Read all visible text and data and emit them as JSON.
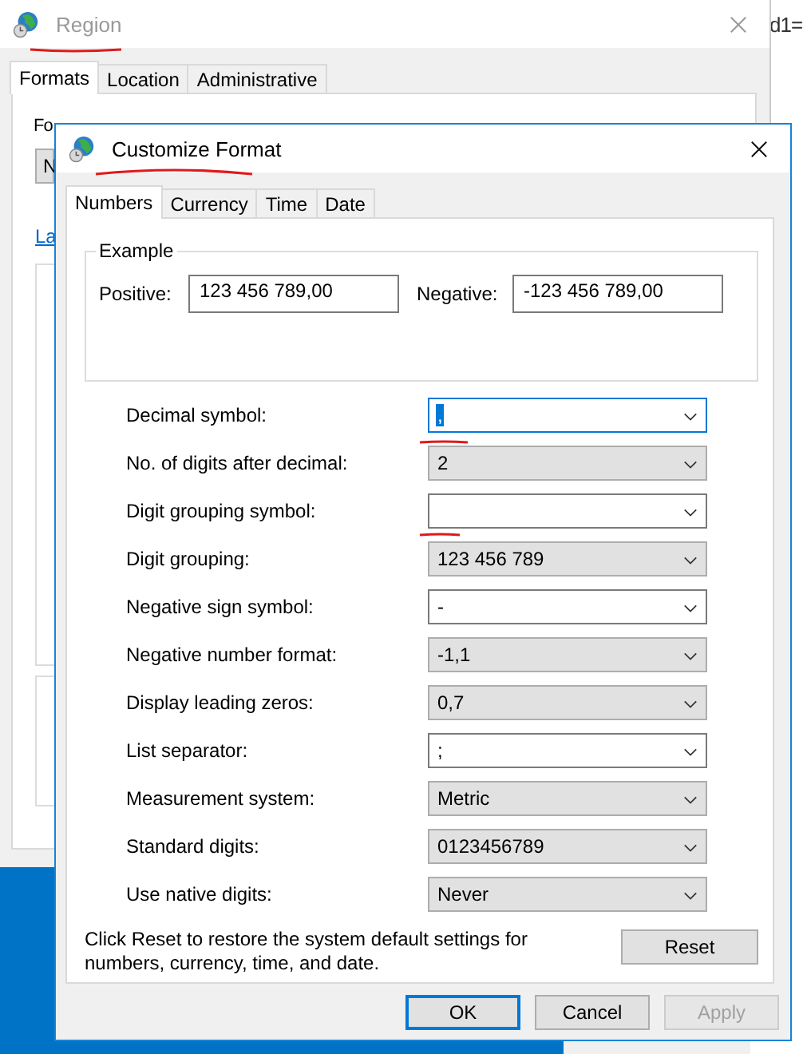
{
  "background_app": {
    "text": "d1="
  },
  "region_window": {
    "title": "Region",
    "tabs": [
      {
        "label": "Formats",
        "selected": true
      },
      {
        "label": "Location",
        "selected": false
      },
      {
        "label": "Administrative",
        "selected": false
      }
    ],
    "format_label": "Fo",
    "format_combo": "N",
    "link": "La"
  },
  "dialog": {
    "title": "Customize Format",
    "tabs": [
      {
        "label": "Numbers",
        "selected": true
      },
      {
        "label": "Currency",
        "selected": false
      },
      {
        "label": "Time",
        "selected": false
      },
      {
        "label": "Date",
        "selected": false
      }
    ],
    "example": {
      "title": "Example",
      "positive_label": "Positive:",
      "positive": "123 456 789,00",
      "negative_label": "Negative:",
      "negative": "-123 456 789,00"
    },
    "settings": [
      {
        "label": "Decimal symbol:",
        "value": ",",
        "kind": "editable",
        "focused": true
      },
      {
        "label": "No. of digits after decimal:",
        "value": "2",
        "kind": "list",
        "focused": false
      },
      {
        "label": "Digit grouping symbol:",
        "kind": "editable",
        "focused": false
      },
      {
        "label": "Digit grouping:",
        "value": "123 456 789",
        "kind": "list",
        "focused": false
      },
      {
        "label": "Negative sign symbol:",
        "value": "-",
        "kind": "editable",
        "focused": false
      },
      {
        "label": "Negative number format:",
        "value": "-1,1",
        "kind": "list",
        "focused": false
      },
      {
        "label": "Display leading zeros:",
        "value": "0,7",
        "kind": "list",
        "focused": false
      },
      {
        "label": "List separator:",
        "value": ";",
        "kind": "editable",
        "focused": false
      },
      {
        "label": "Measurement system:",
        "value": "Metric",
        "kind": "list",
        "focused": false
      },
      {
        "label": "Standard digits:",
        "value": "0123456789",
        "kind": "list",
        "focused": false
      },
      {
        "label": "Use native digits:",
        "value": "Never",
        "kind": "list",
        "focused": false
      }
    ],
    "reset_note": "Click Reset to restore the system default settings for numbers, currency, time, and date.",
    "reset_button": "Reset",
    "buttons": [
      {
        "label": "OK",
        "kind": "default"
      },
      {
        "label": "Cancel",
        "kind": "normal"
      },
      {
        "label": "Apply",
        "kind": "disabled"
      }
    ]
  }
}
